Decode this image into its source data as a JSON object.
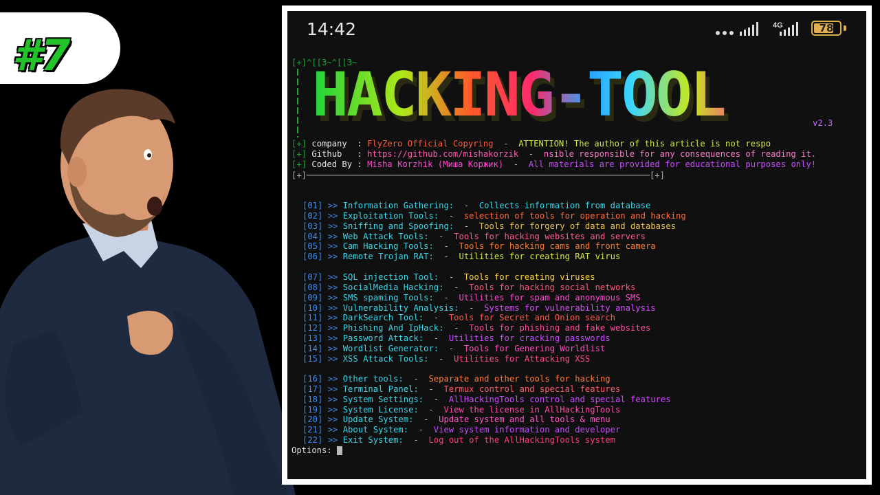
{
  "badge": {
    "text": "#7"
  },
  "status": {
    "time": "14:42",
    "network": "4G",
    "battery": "78",
    "battery_level": 0.78
  },
  "terminal": {
    "escape_line": "[+]^[[3~^[[3~",
    "banner": "HACKING-TOOL",
    "version": "v2.3",
    "info": [
      {
        "prefix": "[+]",
        "key": "company  :",
        "value": "FlyZero Official Copyring",
        "sep": "  -  ",
        "note": "ATTENTION! The author of this article is not respo"
      },
      {
        "prefix": "[+]",
        "key": "Github   :",
        "value": "https://github.com/mishakorzik",
        "sep": "  -  ",
        "note": "nsible responsible for any consequences of reading it."
      },
      {
        "prefix": "[+]",
        "key": "Coded By :",
        "value": "Misha Korzhik (Миша Коржик)",
        "sep": "  -  ",
        "note": "All materials are provided for educational purposes only!"
      }
    ],
    "divider": "[+]────────────────────────────────────────────────────────────────────[+]",
    "prompt": "Options: ",
    "menu": [
      {
        "num": "[01]",
        "name": "Information Gathering:",
        "desc": "Collects information from database",
        "color": "#3ad6e8"
      },
      {
        "num": "[02]",
        "name": "Exploitation Tools:",
        "desc": "selection of tools for operation and hacking",
        "color": "#ff6a3a"
      },
      {
        "num": "[03]",
        "name": "Sniffing and Spoofing:",
        "desc": "Tools for forgery of data and databases",
        "color": "#e8c24a"
      },
      {
        "num": "[04]",
        "name": "Web Attack Tools:",
        "desc": "Tools for hacking websites and servers",
        "color": "#ff5a9a"
      },
      {
        "num": "[05]",
        "name": "Cam Hacking Tools:",
        "desc": "Tools for hacking cams and front camera",
        "color": "#ff7a2a"
      },
      {
        "num": "[06]",
        "name": "Remote Trojan RAT:",
        "desc": "Utilities for creating RAT virus",
        "color": "#d8e84a"
      },
      {
        "num": "[07]",
        "name": "SQL injection Tool:",
        "desc": "Tools for creating viruses",
        "color": "#ffd23a"
      },
      {
        "num": "[08]",
        "name": "SocialMedia Hacking:",
        "desc": "Tools for hacking social networks",
        "color": "#ff5a7a"
      },
      {
        "num": "[09]",
        "name": "SMS spaming Tools:",
        "desc": "Utilities for spam and anonymous SMS",
        "color": "#ff4ad0"
      },
      {
        "num": "[10]",
        "name": "Vulnerability Analysis:",
        "desc": "Systems for vulnerability analysis",
        "color": "#d84aff"
      },
      {
        "num": "[11]",
        "name": "DarkSearch Tool:",
        "desc": "Tools for Secret and Onion search",
        "color": "#ff5a4a"
      },
      {
        "num": "[12]",
        "name": "Phishing And IpHack:",
        "desc": "Tools for phishing and fake websites",
        "color": "#ff4aa0"
      },
      {
        "num": "[13]",
        "name": "Password Attack:",
        "desc": "Utilities for cracking passwords",
        "color": "#c84aff"
      },
      {
        "num": "[14]",
        "name": "Wordlist Generator:",
        "desc": "Tools for Genering Worldlist",
        "color": "#ff4ac0"
      },
      {
        "num": "[15]",
        "name": "XSS Attack Tools:",
        "desc": "Utilities for Attacking XSS",
        "color": "#ff4a90"
      },
      {
        "num": "[16]",
        "name": "Other tools:",
        "desc": "Separate and other tools for hacking",
        "color": "#ff7a3a"
      },
      {
        "num": "[17]",
        "name": "Terminal Panel:",
        "desc": "Termux control and special features",
        "color": "#ff5a6a"
      },
      {
        "num": "[18]",
        "name": "System Settings:",
        "desc": "AllHackingTools control and special features",
        "color": "#d04aff"
      },
      {
        "num": "[19]",
        "name": "System License:",
        "desc": "View the license in AllHackingTools",
        "color": "#ff4aa8"
      },
      {
        "num": "[20]",
        "name": "Update System:",
        "desc": "Update system and all tools & menu",
        "color": "#ff5ac8"
      },
      {
        "num": "[21]",
        "name": "About System:",
        "desc": "View system information and developer",
        "color": "#c84aff"
      },
      {
        "num": "[22]",
        "name": "Exit System:",
        "desc": "Log out of the AllHackingTools system",
        "color": "#ff3a7a"
      }
    ]
  }
}
